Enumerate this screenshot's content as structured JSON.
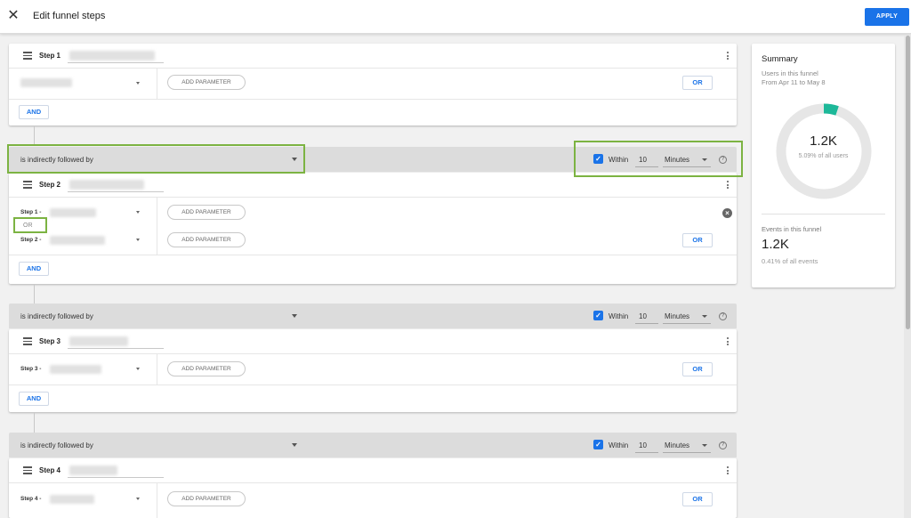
{
  "header": {
    "title": "Edit funnel steps",
    "apply_label": "APPLY"
  },
  "colors": {
    "accent": "#1a73e8",
    "highlight": "#7cb342",
    "donut_fill": "#1db899",
    "donut_track": "#e6e6e6"
  },
  "steps": [
    {
      "name": "Step 1",
      "rows": [
        {
          "label": ""
        }
      ],
      "add_param": "ADD PARAMETER",
      "or": "OR",
      "and": "AND"
    },
    {
      "name": "Step 2",
      "rows": [
        {
          "label": "Step 1 -"
        },
        {
          "label": "Step 2 -"
        }
      ],
      "row_or": "OR",
      "add_param": "ADD PARAMETER",
      "or": "OR",
      "and": "AND"
    },
    {
      "name": "Step 3",
      "rows": [
        {
          "label": "Step 3 -"
        }
      ],
      "add_param": "ADD PARAMETER",
      "or": "OR",
      "and": "AND"
    },
    {
      "name": "Step 4",
      "rows": [
        {
          "label": "Step 4 -"
        }
      ],
      "add_param": "ADD PARAMETER",
      "or": "OR"
    }
  ],
  "connectors": [
    {
      "relation": "is indirectly followed by",
      "within_checked": true,
      "within_label": "Within",
      "within_value": "10",
      "unit": "Minutes",
      "help": "?"
    },
    {
      "relation": "is indirectly followed by",
      "within_checked": true,
      "within_label": "Within",
      "within_value": "10",
      "unit": "Minutes",
      "help": "?"
    },
    {
      "relation": "is indirectly followed by",
      "within_checked": true,
      "within_label": "Within",
      "within_value": "10",
      "unit": "Minutes",
      "help": "?"
    }
  ],
  "summary": {
    "title": "Summary",
    "users_label": "Users in this funnel",
    "date_range": "From Apr 11 to May 8",
    "users_value": "1.2K",
    "users_pct": "5.09% of all users",
    "users_fraction": 0.0509,
    "events_label": "Events in this funnel",
    "events_value": "1.2K",
    "events_pct": "0.41% of all events"
  }
}
